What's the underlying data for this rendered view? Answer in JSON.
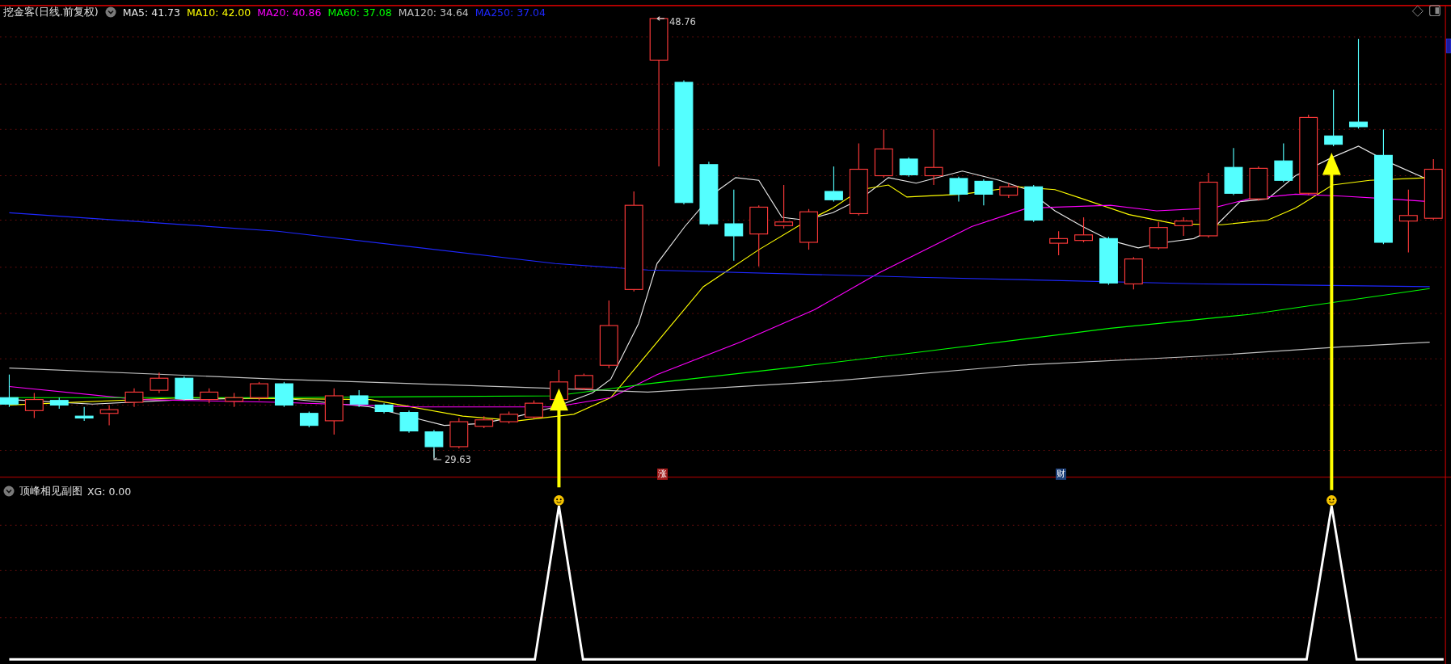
{
  "main_chart": {
    "title": "挖金客(日线.前复权)",
    "indicators": [
      {
        "label": "MA5: 41.73",
        "color": "#e8e8e8"
      },
      {
        "label": "MA10: 42.00",
        "color": "#ffff00"
      },
      {
        "label": "MA20: 40.86",
        "color": "#ff00ff"
      },
      {
        "label": "MA60: 37.08",
        "color": "#00ff00"
      },
      {
        "label": "MA120: 34.64",
        "color": "#c0c0c0"
      },
      {
        "label": "MA250: 37.04",
        "color": "#1e28ff"
      }
    ],
    "high_label": "48.76",
    "low_label": "29.63",
    "markers": [
      {
        "text": "涨",
        "color": "#a01818"
      },
      {
        "text": "财",
        "color": "#1d3f78"
      }
    ]
  },
  "sub_chart": {
    "title": "顶峰相见副图",
    "reading": "XG: 0.00"
  }
}
